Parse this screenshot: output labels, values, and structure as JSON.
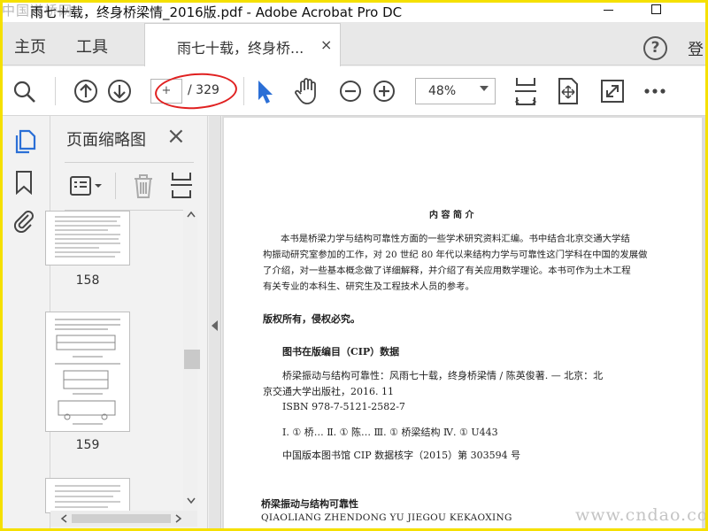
{
  "titlebar": {
    "watermark": "中国道桥网",
    "title": "雨七十载，终身桥梁情_2016版.pdf - Adobe Acrobat Pro DC"
  },
  "menubar": {
    "home": "主页",
    "tools": "工具",
    "tab_title": "雨七十载，终身桥...",
    "tab_close": "×",
    "help": "?",
    "login": "登"
  },
  "toolbar": {
    "page_current": "+",
    "page_total": "/ 329",
    "zoom": "48%"
  },
  "panel": {
    "title": "页面缩略图",
    "close": "×",
    "thumbnails": [
      {
        "page": "158"
      },
      {
        "page": "159"
      }
    ]
  },
  "doc": {
    "heading": "内 容 简 介",
    "summary_lines": [
      "本书是桥梁力学与结构可靠性方面的一些学术研究资料汇编。书中结合北京交通大学结",
      "构振动研究室参加的工作，对 20 世纪 80 年代以来结构力学与可靠性这门学科在中国的发展做",
      "了介绍，对一些基本概念做了详细解释，并介绍了有关应用数学理论。本书可作为土木工程",
      "有关专业的本科生、研究生及工程技术人员的参考。"
    ],
    "copyright": "版权所有，侵权必究。",
    "cip_title": "图书在版编目（CIP）数据",
    "cip_lines": [
      "桥梁振动与结构可靠性：风雨七十载，终身桥梁情 / 陈英俊著. — 北京：北",
      "京交通大学出版社，2016. 11",
      "ISBN 978-7-5121-2582-7",
      "Ⅰ. ① 桥…   Ⅱ. ① 陈…   Ⅲ. ① 桥梁结构   Ⅳ. ① U443",
      "中国版本图书馆 CIP 数据核字（2015）第 303594 号"
    ],
    "book_title": "桥梁振动与结构可靠性",
    "book_pinyin": "QIAOLIANG ZHENDONG YU JIEGOU KEKAOXING"
  },
  "watermark_corner": "www.cndao.com",
  "colors": {
    "frame": "#f5e000",
    "accent_blue": "#2b6fd6",
    "annotation_red": "#e02020"
  }
}
